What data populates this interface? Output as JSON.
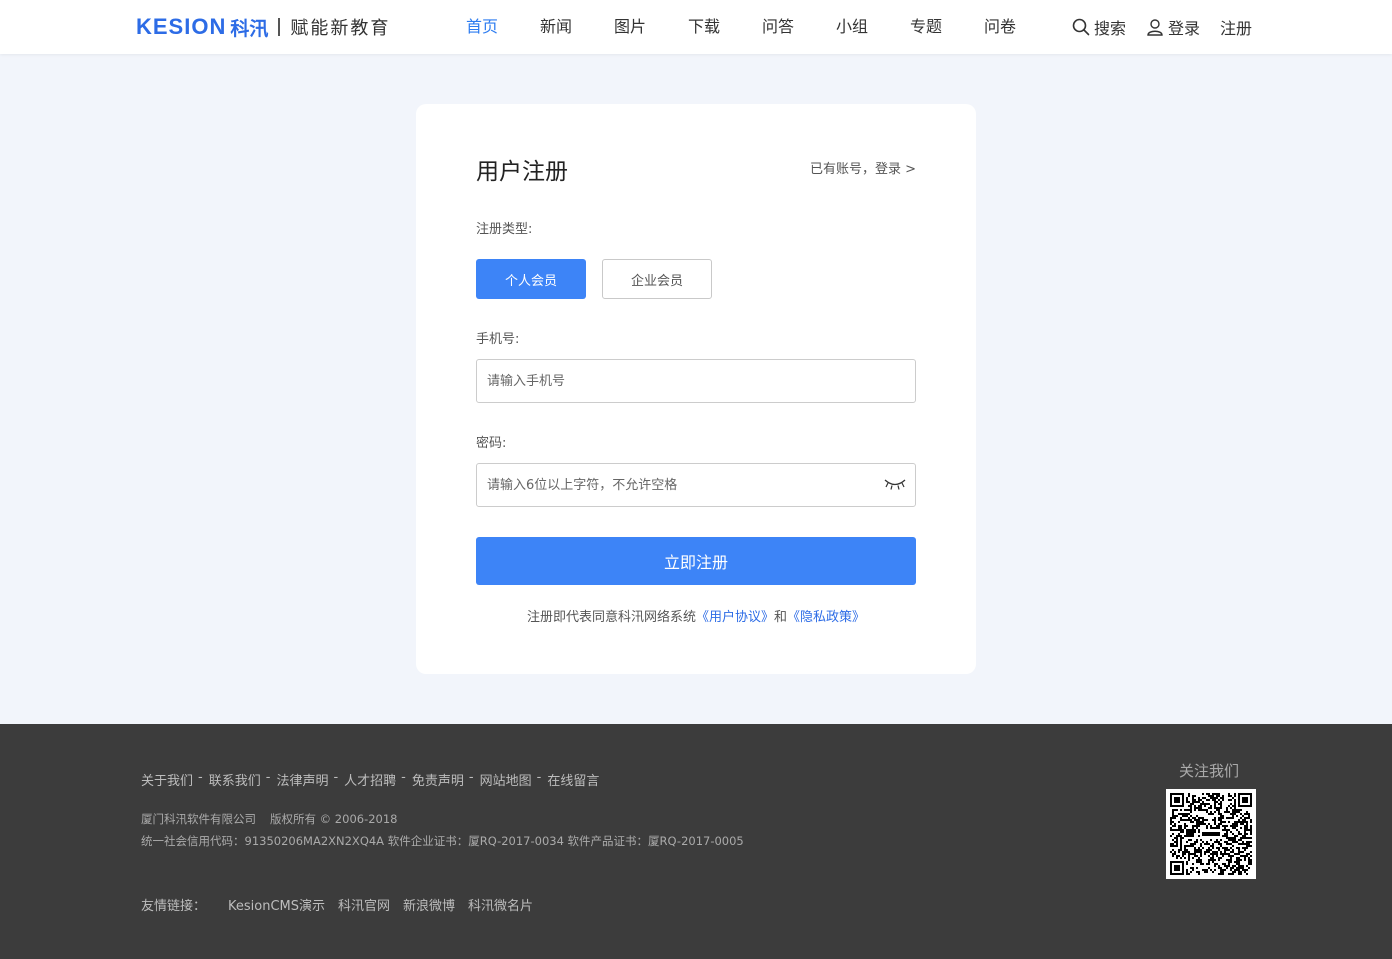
{
  "header": {
    "logo_brand": "KESION",
    "logo_cn": "科汛",
    "logo_slogan": "赋能新教育",
    "nav": [
      "首页",
      "新闻",
      "图片",
      "下载",
      "问答",
      "小组",
      "专题",
      "问卷"
    ],
    "active_nav": "首页",
    "search_label": "搜索",
    "login_label": "登录",
    "register_label": "注册"
  },
  "form": {
    "title": "用户注册",
    "login_link": "已有账号，登录 >",
    "type_label": "注册类型:",
    "type_personal": "个人会员",
    "type_enterprise": "企业会员",
    "phone_label": "手机号:",
    "phone_placeholder": "请输入手机号",
    "password_label": "密码:",
    "password_placeholder": "请输入6位以上字符，不允许空格",
    "submit_label": "立即注册",
    "agree_prefix": "注册即代表同意科汛网络系统",
    "agree_user": "《用户协议》",
    "agree_and": "和",
    "agree_privacy": "《隐私政策》"
  },
  "footer": {
    "links": [
      "关于我们",
      "联系我们",
      "法律声明",
      "人才招聘",
      "免责声明",
      "网站地图",
      "在线留言"
    ],
    "company": "厦门科汛软件有限公司",
    "copyright": "版权所有 © 2006-2018",
    "credit_line": "统一社会信用代码：91350206MA2XN2XQ4A 软件企业证书：厦RQ-2017-0034 软件产品证书：厦RQ-2017-0005",
    "friend_label": "友情链接：",
    "friend_links": [
      "KesionCMS演示",
      "科汛官网",
      "新浪微博",
      "科汛微名片"
    ],
    "follow_label": "关注我们"
  },
  "colors": {
    "accent": "#3d84f7",
    "brand": "#2d6ce6",
    "page_bg": "#f2f5fb",
    "footer_bg": "#3c3c3c"
  }
}
